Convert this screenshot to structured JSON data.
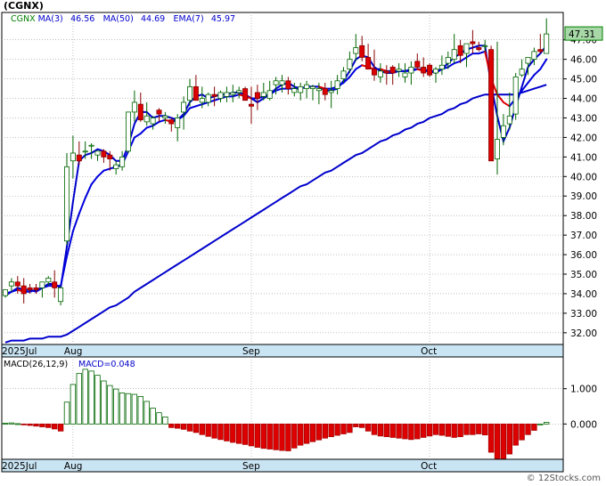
{
  "title": "(CGNX)",
  "watermark": "© 12Stocks.com",
  "price_legend": [
    {
      "text": "CGNX",
      "color": "#008000"
    },
    {
      "text": "MA(3)",
      "color": "#0000cc"
    },
    {
      "text": "46.56",
      "color": "#0000cc"
    },
    {
      "text": "MA(50)",
      "color": "#0000cc"
    },
    {
      "text": "44.69",
      "color": "#0000cc"
    },
    {
      "text": "EMA(7)",
      "color": "#0000cc"
    },
    {
      "text": "45.97",
      "color": "#0000cc"
    }
  ],
  "macd_legend": [
    {
      "text": "MACD(26,12,9)",
      "color": "#000000"
    },
    {
      "text": "MACD=0.048",
      "color": "#0000cc"
    }
  ],
  "last_price_label": "47.31",
  "colors": {
    "up": "#008000",
    "down": "#dd0000",
    "ma_fast": "#0000cc",
    "ema_up": "#0000dd",
    "ema_down": "#dd0000",
    "grid": "#999999",
    "axis_band": "#c9e4f3"
  },
  "chart_data": [
    {
      "type": "candlestick",
      "x_labels": [
        "2025Jul",
        "Aug",
        "Sep",
        "Oct"
      ],
      "y_ticks": [
        "32.00",
        "33.00",
        "34.00",
        "35.00",
        "36.00",
        "37.00",
        "38.00",
        "39.00",
        "40.00",
        "41.00",
        "42.00",
        "43.00",
        "44.00",
        "45.00",
        "46.00",
        "47.00"
      ],
      "y_tick_values": [
        32,
        33,
        34,
        35,
        36,
        37,
        38,
        39,
        40,
        41,
        42,
        43,
        44,
        45,
        46,
        47
      ],
      "ylim": [
        31.4,
        48.4
      ],
      "label_index": [
        0,
        11,
        40,
        69
      ],
      "series": {
        "open": [
          33.9,
          34.4,
          34.6,
          34.4,
          34.3,
          34.3,
          34.3,
          34.6,
          34.6,
          33.6,
          36.7,
          40.8,
          41.1,
          41.3,
          41.6,
          41.1,
          41.3,
          41.1,
          40.4,
          40.5,
          41.3,
          43.3,
          43.7,
          42.8,
          42.7,
          43.4,
          43.0,
          42.9,
          42.5,
          43.3,
          43.9,
          44.6,
          43.8,
          43.8,
          44.2,
          44.0,
          44.1,
          44.2,
          44.3,
          44.5,
          43.7,
          44.3,
          44.1,
          44.0,
          44.7,
          44.7,
          44.9,
          44.3,
          44.3,
          44.5,
          44.5,
          44.4,
          44.5,
          44.3,
          44.5,
          45.0,
          45.5,
          46.3,
          46.7,
          46.1,
          45.5,
          45.1,
          45.4,
          45.6,
          45.4,
          45.1,
          45.3,
          45.9,
          45.6,
          45.7,
          45.3,
          45.5,
          45.8,
          46.0,
          46.7,
          46.3,
          46.9,
          46.6,
          46.7,
          46.5,
          40.9,
          42.0,
          42.7,
          43.2,
          45.2,
          45.8,
          46.0,
          46.5,
          46.3
        ],
        "high": [
          34.2,
          34.8,
          34.9,
          34.8,
          34.5,
          34.5,
          34.5,
          34.9,
          35.2,
          34.4,
          41.2,
          42.1,
          41.8,
          41.8,
          41.7,
          41.3,
          41.4,
          41.3,
          40.8,
          41.3,
          43.3,
          44.4,
          44.3,
          43.8,
          43.1,
          43.5,
          43.3,
          43.0,
          43.2,
          44.1,
          45.0,
          45.2,
          44.6,
          44.3,
          44.6,
          44.4,
          44.6,
          44.7,
          44.6,
          44.6,
          44.6,
          44.7,
          44.8,
          44.9,
          45.1,
          45.2,
          45.1,
          44.8,
          44.8,
          44.9,
          44.7,
          44.8,
          44.8,
          44.9,
          45.2,
          45.6,
          46.4,
          47.3,
          47.2,
          46.8,
          46.5,
          45.8,
          45.7,
          45.7,
          45.8,
          45.8,
          45.9,
          46.3,
          46.1,
          45.8,
          45.6,
          46.2,
          46.4,
          47.3,
          47.0,
          46.8,
          47.5,
          46.9,
          47.0,
          46.7,
          46.9,
          43.2,
          44.3,
          45.3,
          46.0,
          46.1,
          46.6,
          47.3,
          48.1
        ],
        "low": [
          33.8,
          34.1,
          34.0,
          33.5,
          34.0,
          34.0,
          33.8,
          34.4,
          33.8,
          33.4,
          36.5,
          39.9,
          40.6,
          40.9,
          40.9,
          40.8,
          40.7,
          40.3,
          40.1,
          40.3,
          41.2,
          42.8,
          42.8,
          42.6,
          42.4,
          42.8,
          42.7,
          42.3,
          41.8,
          42.4,
          43.6,
          44.0,
          43.5,
          43.6,
          43.6,
          43.8,
          43.8,
          43.8,
          44.0,
          43.9,
          42.7,
          43.4,
          43.9,
          43.9,
          44.2,
          44.3,
          44.2,
          44.1,
          43.9,
          44.0,
          43.9,
          43.7,
          43.9,
          43.5,
          44.2,
          44.8,
          45.3,
          45.9,
          45.9,
          45.5,
          44.9,
          44.8,
          44.7,
          44.7,
          45.1,
          44.8,
          44.7,
          45.5,
          45.1,
          45.1,
          44.8,
          45.2,
          45.5,
          45.8,
          45.8,
          45.6,
          46.3,
          46.4,
          46.4,
          46.1,
          40.1,
          41.6,
          42.4,
          42.9,
          45.1,
          45.2,
          45.7,
          46.3,
          46.4
        ],
        "close": [
          34.2,
          34.6,
          34.4,
          34.0,
          34.2,
          34.2,
          34.6,
          34.8,
          34.3,
          34.3,
          40.5,
          41.2,
          40.8,
          41.3,
          41.6,
          41.3,
          41.0,
          40.9,
          40.6,
          41.0,
          43.3,
          43.8,
          42.9,
          43.1,
          43.0,
          43.2,
          43.1,
          42.7,
          43.0,
          43.8,
          44.6,
          43.9,
          44.0,
          44.2,
          44.1,
          44.3,
          44.3,
          44.3,
          44.4,
          43.9,
          43.6,
          44.0,
          44.3,
          44.4,
          44.9,
          44.9,
          44.5,
          44.5,
          44.6,
          44.7,
          44.6,
          44.5,
          44.2,
          44.4,
          44.9,
          45.4,
          46.0,
          46.6,
          46.1,
          45.5,
          45.2,
          45.4,
          45.3,
          45.3,
          45.5,
          45.3,
          45.6,
          45.6,
          45.3,
          45.2,
          45.5,
          45.7,
          46.1,
          46.5,
          46.2,
          46.8,
          46.8,
          46.5,
          46.7,
          40.8,
          41.9,
          42.6,
          43.1,
          45.1,
          45.5,
          46.1,
          46.4,
          46.4,
          47.3
        ],
        "ma3": [
          33.9,
          34.1,
          34.3,
          34.2,
          34.2,
          34.1,
          34.3,
          34.5,
          34.5,
          34.3,
          36.4,
          38.7,
          40.8,
          41.1,
          41.2,
          41.4,
          41.3,
          41.1,
          40.8,
          40.8,
          41.6,
          42.7,
          43.3,
          43.3,
          43.0,
          43.1,
          43.1,
          43.0,
          42.9,
          43.2,
          43.8,
          44.1,
          44.2,
          44.0,
          44.1,
          44.2,
          44.2,
          44.3,
          44.3,
          44.2,
          44.0,
          43.8,
          44.0,
          44.2,
          44.5,
          44.7,
          44.8,
          44.6,
          44.5,
          44.6,
          44.6,
          44.6,
          44.4,
          44.4,
          44.5,
          44.9,
          45.4,
          46.0,
          46.2,
          46.1,
          45.6,
          45.4,
          45.3,
          45.3,
          45.4,
          45.4,
          45.5,
          45.5,
          45.5,
          45.4,
          45.3,
          45.5,
          45.8,
          46.1,
          46.3,
          46.5,
          46.6,
          46.7,
          46.7,
          44.7,
          43.1,
          41.8,
          42.5,
          43.6,
          44.6,
          45.6,
          46.0,
          46.3,
          46.7
        ],
        "ma50": [
          31.5,
          31.6,
          31.6,
          31.6,
          31.7,
          31.7,
          31.7,
          31.8,
          31.8,
          31.8,
          31.9,
          32.1,
          32.3,
          32.5,
          32.7,
          32.9,
          33.1,
          33.3,
          33.4,
          33.6,
          33.8,
          34.1,
          34.3,
          34.5,
          34.7,
          34.9,
          35.1,
          35.3,
          35.5,
          35.7,
          35.9,
          36.1,
          36.3,
          36.5,
          36.7,
          36.9,
          37.1,
          37.3,
          37.5,
          37.7,
          37.9,
          38.1,
          38.3,
          38.5,
          38.7,
          38.9,
          39.1,
          39.3,
          39.5,
          39.6,
          39.8,
          40.0,
          40.2,
          40.3,
          40.5,
          40.7,
          40.9,
          41.1,
          41.2,
          41.4,
          41.6,
          41.8,
          41.9,
          42.1,
          42.2,
          42.4,
          42.5,
          42.7,
          42.8,
          43.0,
          43.1,
          43.2,
          43.4,
          43.5,
          43.7,
          43.8,
          44.0,
          44.1,
          44.2,
          44.2,
          44.2,
          44.2,
          44.2,
          44.2,
          44.3,
          44.4,
          44.5,
          44.6,
          44.7
        ],
        "ema7": [
          34.0,
          34.1,
          34.2,
          34.1,
          34.1,
          34.2,
          34.3,
          34.4,
          34.4,
          34.4,
          35.9,
          37.2,
          38.1,
          38.9,
          39.6,
          40.0,
          40.3,
          40.4,
          40.5,
          40.6,
          41.3,
          42.0,
          42.2,
          42.5,
          42.6,
          42.8,
          42.9,
          42.8,
          42.9,
          43.1,
          43.5,
          43.6,
          43.7,
          43.8,
          43.9,
          44.0,
          44.1,
          44.1,
          44.2,
          44.1,
          44.0,
          44.0,
          44.1,
          44.2,
          44.4,
          44.5,
          44.5,
          44.5,
          44.5,
          44.6,
          44.6,
          44.6,
          44.5,
          44.5,
          44.6,
          44.8,
          45.1,
          45.5,
          45.7,
          45.6,
          45.5,
          45.5,
          45.4,
          45.4,
          45.4,
          45.4,
          45.4,
          45.5,
          45.4,
          45.4,
          45.4,
          45.5,
          45.6,
          45.8,
          45.9,
          46.1,
          46.3,
          46.3,
          46.4,
          45.0,
          44.2,
          43.8,
          43.6,
          44.0,
          44.4,
          44.8,
          45.2,
          45.5,
          46.0
        ]
      }
    },
    {
      "type": "bar",
      "title": "MACD(26,12,9)",
      "y_ticks": [
        "1.000",
        "0.000"
      ],
      "y_tick_values": [
        1.0,
        0.0
      ],
      "ylim": [
        -1.0,
        1.9
      ],
      "values": [
        0.02,
        0.03,
        0.01,
        -0.01,
        -0.04,
        -0.06,
        -0.08,
        -0.1,
        -0.14,
        -0.2,
        0.62,
        1.12,
        1.43,
        1.55,
        1.5,
        1.38,
        1.22,
        1.09,
        0.99,
        0.88,
        0.86,
        0.84,
        0.78,
        0.64,
        0.45,
        0.32,
        0.2,
        -0.1,
        -0.12,
        -0.15,
        -0.2,
        -0.24,
        -0.3,
        -0.35,
        -0.4,
        -0.44,
        -0.48,
        -0.52,
        -0.55,
        -0.58,
        -0.62,
        -0.66,
        -0.69,
        -0.71,
        -0.73,
        -0.75,
        -0.76,
        -0.68,
        -0.6,
        -0.55,
        -0.5,
        -0.45,
        -0.4,
        -0.36,
        -0.32,
        -0.28,
        -0.24,
        -0.08,
        -0.1,
        -0.2,
        -0.3,
        -0.34,
        -0.36,
        -0.38,
        -0.4,
        -0.42,
        -0.44,
        -0.42,
        -0.38,
        -0.34,
        -0.3,
        -0.32,
        -0.35,
        -0.38,
        -0.36,
        -0.3,
        -0.3,
        -0.28,
        -0.31,
        -0.8,
        -0.98,
        -0.98,
        -0.85,
        -0.6,
        -0.45,
        -0.3,
        -0.18,
        0.0,
        0.048
      ]
    }
  ]
}
